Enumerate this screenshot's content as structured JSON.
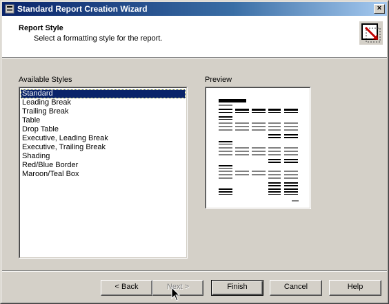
{
  "window": {
    "title": "Standard Report Creation Wizard",
    "close_label": "×"
  },
  "header": {
    "title": "Report Style",
    "subtitle": "Select a formatting style for the report.",
    "icon": "report-style-wizard-icon"
  },
  "styles": {
    "label": "Available Styles",
    "selected_index": 0,
    "items": [
      "Standard",
      "Leading Break",
      "Trailing Break",
      "Table",
      "Drop Table",
      "Executive, Leading Break",
      "Executive, Trailing Break",
      "Shading",
      "Red/Blue Border",
      "Maroon/Teal Box"
    ]
  },
  "preview": {
    "label": "Preview",
    "style": "Standard"
  },
  "buttons": {
    "back": "< Back",
    "next": "Next >",
    "finish": "Finish",
    "cancel": "Cancel",
    "help": "Help"
  },
  "colors": {
    "titlebar_start": "#0a246a",
    "titlebar_end": "#a6caf0",
    "selection": "#0a246a",
    "face": "#d4d0c8"
  }
}
